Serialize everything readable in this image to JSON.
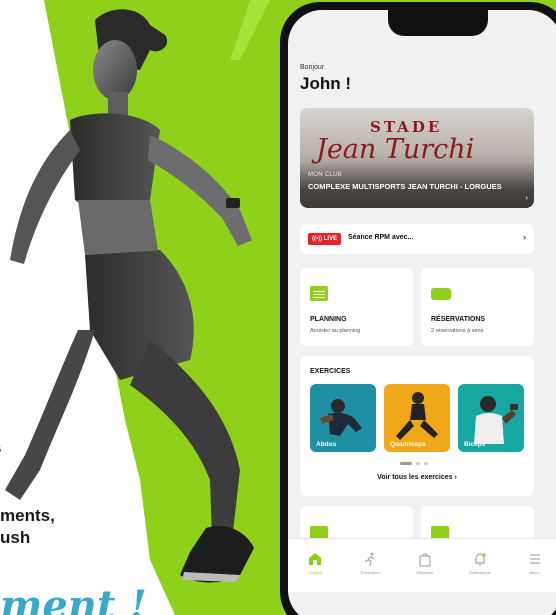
{
  "promo": {
    "line1": "s",
    "line2": "ments,",
    "line3": "ush",
    "script": "ment !"
  },
  "app": {
    "greeting": "Bonjour",
    "username": "John !",
    "club": {
      "image_text_top": "STADE",
      "image_text_script": "Jean Turchi",
      "label": "MON CLUB",
      "name": "COMPLEXE MULTISPORTS JEAN TURCHI - LORGUES",
      "chevron": "›"
    },
    "live": {
      "badge": "((•)) LIVE",
      "text": "Séance RPM avec...",
      "chevron": "›"
    },
    "tiles": [
      {
        "title": "PLANNING",
        "subtitle": "Accéder au planning",
        "icon": "calendar-icon"
      },
      {
        "title": "RÉSERVATIONS",
        "subtitle": "2 réservations à venir",
        "icon": "ticket-icon"
      }
    ],
    "exercises": {
      "title": "EXERCICES",
      "items": [
        {
          "label": "Abdos"
        },
        {
          "label": "Quadriceps"
        },
        {
          "label": "Biceps"
        }
      ],
      "see_all": "Voir tous les exercices ›"
    },
    "tabbar": [
      {
        "label": "Accueil",
        "icon": "home-icon",
        "active": true
      },
      {
        "label": "S'entraîner",
        "icon": "runner-icon",
        "active": false
      },
      {
        "label": "Réserver",
        "icon": "bag-icon",
        "active": false
      },
      {
        "label": "Notifications",
        "icon": "bell-icon",
        "active": false
      },
      {
        "label": "Menu",
        "icon": "menu-icon",
        "active": false
      }
    ]
  },
  "colors": {
    "accent": "#8fd11a",
    "live": "#e8202a",
    "script_accent": "#3aa9c9"
  }
}
